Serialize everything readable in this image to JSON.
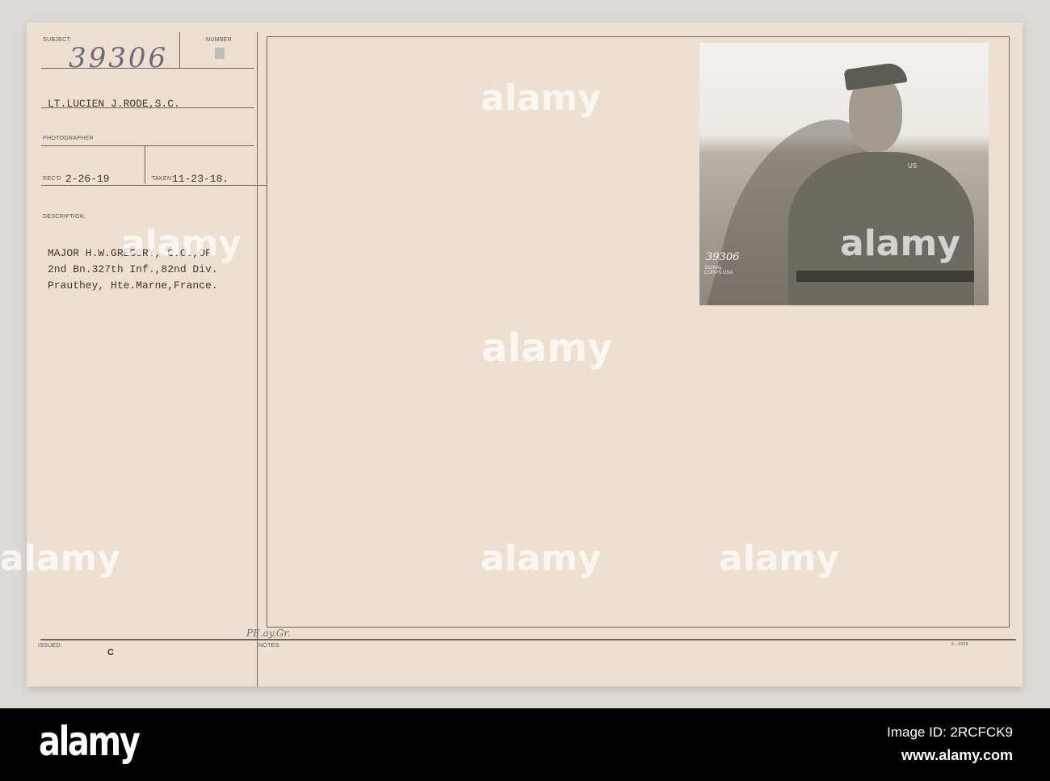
{
  "card": {
    "subject_label": "SUBJECT:",
    "subject_number": "39306",
    "number_label": "NUMBER",
    "photographer_name": "LT.LUCIEN J.RODE,S.C.",
    "photographer_label": "PHOTOGRAPHER",
    "recd_label": "REC'D",
    "recd_date": "2-26-19",
    "taken_label": "TAKEN",
    "taken_date": "11-23-18.",
    "description_label": "DESCRIPTION.",
    "description_lines": [
      "MAJOR H.W.GREGORY, C.O.,OF",
      "2nd Bn.327th Inf.,82nd Div.",
      "Prauthey, Hte.Marne,France."
    ],
    "issued_label": "ISSUED:",
    "issued_value": "C",
    "notes_label": "NOTES:",
    "notes_handwritten": "PE.ay.Gr.",
    "form_number": "9—5008"
  },
  "photo": {
    "stamp_number": "39306",
    "stamp_text": "SIGNAL CORPS USA",
    "collar_text": "US"
  },
  "footer": {
    "logo": "alamy",
    "image_id": "Image ID: 2RCFCK9",
    "url": "www.alamy.com"
  },
  "watermark": "alamy"
}
